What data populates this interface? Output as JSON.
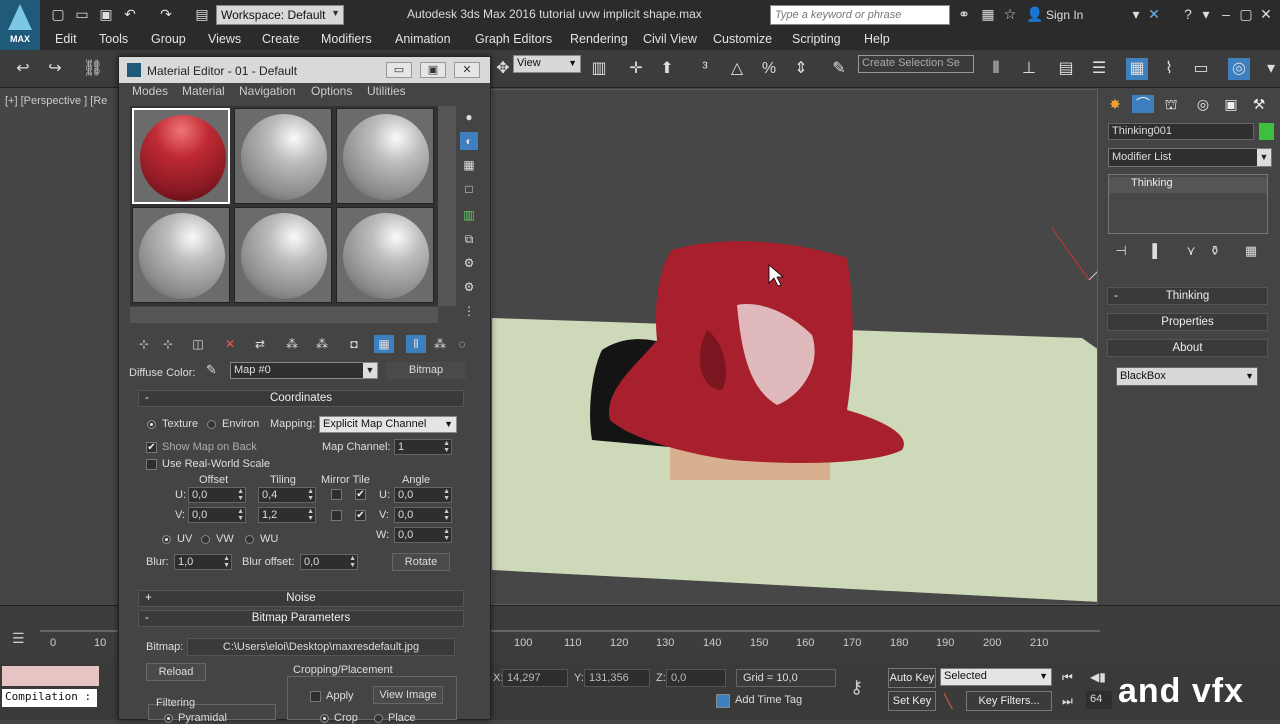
{
  "titlebar": {
    "workspace": "Workspace: Default",
    "app_title": "Autodesk 3ds Max 2016    tutorial uvw implicit shape.max",
    "search_placeholder": "Type a keyword or phrase",
    "sign_in": "Sign In",
    "logo": "MAX"
  },
  "menu": [
    "Edit",
    "Tools",
    "Group",
    "Views",
    "Create",
    "Modifiers",
    "Animation",
    "Graph Editors",
    "Rendering",
    "Civil View",
    "Customize",
    "Scripting",
    "Help"
  ],
  "toolbar": {
    "view_dropdown": "View",
    "selection_set": "Create Selection Se"
  },
  "viewport": {
    "label": "[+] [Perspective ] [Re"
  },
  "command_panel": {
    "object_name": "Thinking001",
    "object_color": "#3fbf3f",
    "modifier_list": "Modifier List",
    "stack_items": [
      "Thinking"
    ],
    "rollouts": [
      "Thinking",
      "Properties",
      "About"
    ],
    "renderer_dropdown": "BlackBox"
  },
  "material_editor": {
    "title": "Material Editor - 01 - Default",
    "menu": [
      "Modes",
      "Material",
      "Navigation",
      "Options",
      "Utilities"
    ],
    "diffuse_label": "Diffuse Color:",
    "map_name": "Map #0",
    "map_type": "Bitmap",
    "coordinates": {
      "header": "Coordinates",
      "texture": "Texture",
      "environ": "Environ",
      "mapping_label": "Mapping:",
      "mapping_value": "Explicit Map Channel",
      "show_map_on_back": "Show Map on Back",
      "map_channel_label": "Map Channel:",
      "map_channel_value": "1",
      "real_world": "Use Real-World Scale",
      "offset_label": "Offset",
      "tiling_label": "Tiling",
      "mirror_tile_label": "Mirror Tile",
      "angle_label": "Angle",
      "u_label": "U:",
      "v_label": "V:",
      "w_label": "W:",
      "offset_u": "0,0",
      "offset_v": "0,0",
      "tiling_u": "0,4",
      "tiling_v": "1,2",
      "angle_u": "0,0",
      "angle_v": "0,0",
      "angle_w": "0,0",
      "uv": "UV",
      "vw": "VW",
      "wu": "WU",
      "blur_label": "Blur:",
      "blur_value": "1,0",
      "blur_offset_label": "Blur offset:",
      "blur_offset_value": "0,0",
      "rotate": "Rotate"
    },
    "noise_header": "Noise",
    "bitmap_params_header": "Bitmap Parameters",
    "bitmap_label": "Bitmap:",
    "bitmap_path": "C:\\Users\\eloi\\Desktop\\maxresdefault.jpg",
    "reload": "Reload",
    "cropping_label": "Cropping/Placement",
    "apply": "Apply",
    "view_image": "View Image",
    "filtering_label": "Filtering",
    "pyramidal": "Pyramidal",
    "crop": "Crop",
    "place": "Place"
  },
  "timeline": {
    "ticks_left": [
      "0",
      "10"
    ],
    "ticks_right": [
      "100",
      "110",
      "120",
      "130",
      "140",
      "150",
      "160",
      "170",
      "180",
      "190",
      "200",
      "210"
    ]
  },
  "status": {
    "compilation": "Compilation :",
    "x_label": "X:",
    "x_value": "14,297",
    "y_label": "Y:",
    "y_value": "131,356",
    "z_label": "Z:",
    "z_value": "0,0",
    "grid": "Grid = 10,0",
    "add_time_tag": "Add Time Tag",
    "auto_key": "Auto Key",
    "set_key": "Set Key",
    "selected": "Selected",
    "key_filters": "Key Filters...",
    "frame": "64",
    "watermark": "and vfx"
  }
}
